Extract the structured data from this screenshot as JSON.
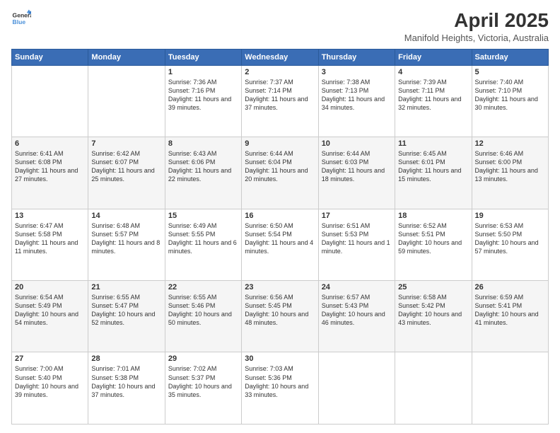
{
  "header": {
    "logo_line1": "General",
    "logo_line2": "Blue",
    "title": "April 2025",
    "subtitle": "Manifold Heights, Victoria, Australia"
  },
  "weekdays": [
    "Sunday",
    "Monday",
    "Tuesday",
    "Wednesday",
    "Thursday",
    "Friday",
    "Saturday"
  ],
  "weeks": [
    [
      null,
      null,
      {
        "day": "1",
        "sunrise": "7:36 AM",
        "sunset": "7:16 PM",
        "daylight": "11 hours and 39 minutes."
      },
      {
        "day": "2",
        "sunrise": "7:37 AM",
        "sunset": "7:14 PM",
        "daylight": "11 hours and 37 minutes."
      },
      {
        "day": "3",
        "sunrise": "7:38 AM",
        "sunset": "7:13 PM",
        "daylight": "11 hours and 34 minutes."
      },
      {
        "day": "4",
        "sunrise": "7:39 AM",
        "sunset": "7:11 PM",
        "daylight": "11 hours and 32 minutes."
      },
      {
        "day": "5",
        "sunrise": "7:40 AM",
        "sunset": "7:10 PM",
        "daylight": "11 hours and 30 minutes."
      }
    ],
    [
      {
        "day": "6",
        "sunrise": "6:41 AM",
        "sunset": "6:08 PM",
        "daylight": "11 hours and 27 minutes."
      },
      {
        "day": "7",
        "sunrise": "6:42 AM",
        "sunset": "6:07 PM",
        "daylight": "11 hours and 25 minutes."
      },
      {
        "day": "8",
        "sunrise": "6:43 AM",
        "sunset": "6:06 PM",
        "daylight": "11 hours and 22 minutes."
      },
      {
        "day": "9",
        "sunrise": "6:44 AM",
        "sunset": "6:04 PM",
        "daylight": "11 hours and 20 minutes."
      },
      {
        "day": "10",
        "sunrise": "6:44 AM",
        "sunset": "6:03 PM",
        "daylight": "11 hours and 18 minutes."
      },
      {
        "day": "11",
        "sunrise": "6:45 AM",
        "sunset": "6:01 PM",
        "daylight": "11 hours and 15 minutes."
      },
      {
        "day": "12",
        "sunrise": "6:46 AM",
        "sunset": "6:00 PM",
        "daylight": "11 hours and 13 minutes."
      }
    ],
    [
      {
        "day": "13",
        "sunrise": "6:47 AM",
        "sunset": "5:58 PM",
        "daylight": "11 hours and 11 minutes."
      },
      {
        "day": "14",
        "sunrise": "6:48 AM",
        "sunset": "5:57 PM",
        "daylight": "11 hours and 8 minutes."
      },
      {
        "day": "15",
        "sunrise": "6:49 AM",
        "sunset": "5:55 PM",
        "daylight": "11 hours and 6 minutes."
      },
      {
        "day": "16",
        "sunrise": "6:50 AM",
        "sunset": "5:54 PM",
        "daylight": "11 hours and 4 minutes."
      },
      {
        "day": "17",
        "sunrise": "6:51 AM",
        "sunset": "5:53 PM",
        "daylight": "11 hours and 1 minute."
      },
      {
        "day": "18",
        "sunrise": "6:52 AM",
        "sunset": "5:51 PM",
        "daylight": "10 hours and 59 minutes."
      },
      {
        "day": "19",
        "sunrise": "6:53 AM",
        "sunset": "5:50 PM",
        "daylight": "10 hours and 57 minutes."
      }
    ],
    [
      {
        "day": "20",
        "sunrise": "6:54 AM",
        "sunset": "5:49 PM",
        "daylight": "10 hours and 54 minutes."
      },
      {
        "day": "21",
        "sunrise": "6:55 AM",
        "sunset": "5:47 PM",
        "daylight": "10 hours and 52 minutes."
      },
      {
        "day": "22",
        "sunrise": "6:55 AM",
        "sunset": "5:46 PM",
        "daylight": "10 hours and 50 minutes."
      },
      {
        "day": "23",
        "sunrise": "6:56 AM",
        "sunset": "5:45 PM",
        "daylight": "10 hours and 48 minutes."
      },
      {
        "day": "24",
        "sunrise": "6:57 AM",
        "sunset": "5:43 PM",
        "daylight": "10 hours and 46 minutes."
      },
      {
        "day": "25",
        "sunrise": "6:58 AM",
        "sunset": "5:42 PM",
        "daylight": "10 hours and 43 minutes."
      },
      {
        "day": "26",
        "sunrise": "6:59 AM",
        "sunset": "5:41 PM",
        "daylight": "10 hours and 41 minutes."
      }
    ],
    [
      {
        "day": "27",
        "sunrise": "7:00 AM",
        "sunset": "5:40 PM",
        "daylight": "10 hours and 39 minutes."
      },
      {
        "day": "28",
        "sunrise": "7:01 AM",
        "sunset": "5:38 PM",
        "daylight": "10 hours and 37 minutes."
      },
      {
        "day": "29",
        "sunrise": "7:02 AM",
        "sunset": "5:37 PM",
        "daylight": "10 hours and 35 minutes."
      },
      {
        "day": "30",
        "sunrise": "7:03 AM",
        "sunset": "5:36 PM",
        "daylight": "10 hours and 33 minutes."
      },
      null,
      null,
      null
    ]
  ],
  "labels": {
    "sunrise": "Sunrise:",
    "sunset": "Sunset:",
    "daylight": "Daylight:"
  }
}
